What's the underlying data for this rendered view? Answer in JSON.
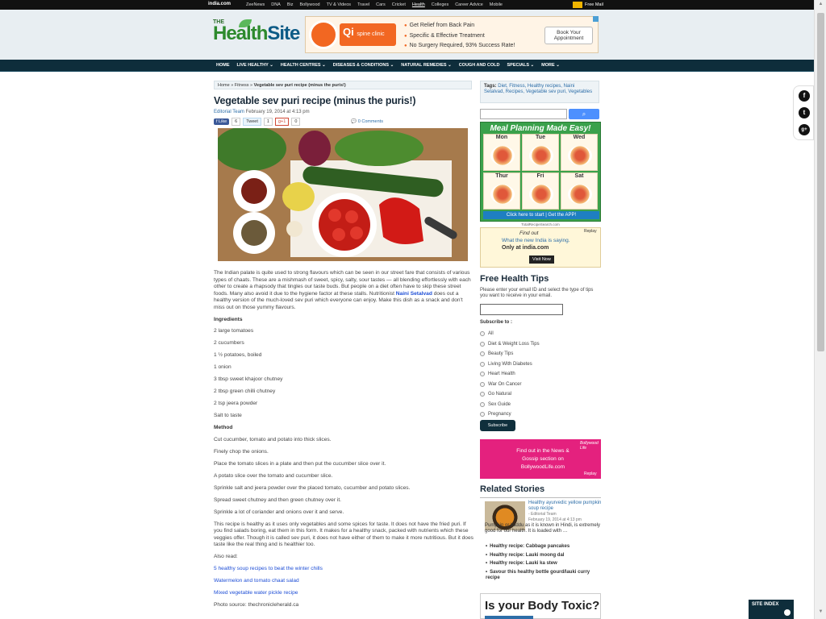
{
  "topbar": {
    "logo": "india.com",
    "nav": [
      "ZeeNews",
      "DNA",
      "Biz",
      "Bollywood",
      "TV & Videos",
      "Travel",
      "Cars",
      "Cricket",
      "Health",
      "Colleges",
      "Career Advice",
      "Mobile"
    ],
    "active": "Health",
    "mail": "Free Mail"
  },
  "header": {
    "logo_the": "THE",
    "logo_health": "Health",
    "logo_site": "Site"
  },
  "ad_banner": {
    "brand": "Qi",
    "brand_sub": "spine clinic",
    "bullets": [
      "Get Relief from Back Pain",
      "Specific & Effective Treatment",
      "No Surgery Required, 93% Success Rate!"
    ],
    "cta": "Book Your Appointment"
  },
  "mainnav": [
    "HOME",
    "LIVE HEALTHY ⌄",
    "HEALTH CENTRES ⌄",
    "DISEASES & CONDITIONS ⌄",
    "NATURAL REMEDIES ⌄",
    "COUGH AND COLD",
    "SPECIALS ⌄",
    "MORE ⌄"
  ],
  "social_float": [
    "f",
    "t",
    "g+"
  ],
  "breadcrumb": {
    "home": "Home",
    "sep": " » ",
    "section": "Fitness",
    "current": "Vegetable sev puri recipe (minus the puris!)"
  },
  "article": {
    "title": "Vegetable sev puri recipe (minus the puris!)",
    "author": "Editorial Team",
    "date": " February 19, 2014 at 4:13 pm",
    "share": {
      "fb": "f Like",
      "fb_count": "6",
      "tw": "Tweet",
      "tw_count": "1",
      "gp": "g+1",
      "gp_count": "0",
      "comments": "0 Comments"
    },
    "intro_a": "The Indian palate is quite used to strong flavours which can be seen in our street fare that consists of various types of chaats. These are a mishmash of sweet, spicy, salty, sour tastes — all blending effortlessly with each other to create a rhapsody that tingles our taste buds. But people on a diet often have to skip these street foods. Many also avoid it due to the hygiene factor at these stalls. Nutritionist ",
    "nutritionist": "Naini Setalvad",
    "intro_b": " does out a healthy version of the much-loved sev puri which everyone can enjoy. Make this dish as a snack and don't miss out on those yummy flavours.",
    "ingredients_heading": "Ingredients",
    "ingredients": [
      "2 large tomatoes",
      "2 cucumbers",
      "1 ½ potatoes, boiled",
      "1 onion",
      "3 tbsp sweet khajoor chutney",
      "2 tbsp green chilli chutney",
      "2 tsp jeera powder",
      "Salt to taste"
    ],
    "method_heading": "Method",
    "method": [
      "Cut cucumber, tomato and potato into thick slices.",
      "Finely chop the onions.",
      "Place the tomato slices in a plate and then put the cucumber slice over it.",
      "A potato slice over the tomato and cucumber slice.",
      "Sprinkle salt and jeera powder over the placed tomato, cucumber and potato slices.",
      "Spread sweet chutney and then green chutney over it.",
      "Sprinkle a lot of coriander and onions over it and serve."
    ],
    "closing": "This recipe is healthy as it uses only vegetables and some spices for taste. It does not have the fried puri. If you find salads boring, eat them in this form. It makes for a healthy snack, packed with nutrients which these veggies offer. Though it is called sev puri, it does not have either of them to make it more nutritious. But it does taste like the real thing and is healthier too.",
    "also_read": "Also read:",
    "links": [
      "5 healthy soup recipes to beat the winter chills",
      "Watermelon and tomato chaat salad",
      "Mixed vegetable water pickle recipe"
    ],
    "photo_source": "Photo source: thechronicleherald.ca"
  },
  "sidebar": {
    "tags_label": "Tags:",
    "tags": "Diet, Fitness, Healthy recipes, Naini Setalvad, Recipes, Vegetable sev puri, Vegetables",
    "meal_ad": {
      "title": "Meal Planning Made Easy!",
      "days": [
        "Mon",
        "Tue",
        "Wed",
        "Thur",
        "Fri",
        "Sat"
      ],
      "cta": "Click here to start  |  Get the APP!",
      "source": "TotalRecipeSearch.com"
    },
    "india_ad": {
      "l1": "Find out",
      "l2": "What the new India is saying.",
      "l3": "Only at india.com",
      "btn": "Visit Now",
      "replay": "Replay"
    },
    "free_tips": {
      "title": "Free Health Tips",
      "desc": "Please enter your email ID and select the type of tips you want to receive in your email.",
      "subscribe_to": "Subscribe to :",
      "options": [
        "All",
        "Diet & Weight Loss Tips",
        "Beauty Tips",
        "Living With Diabetes",
        "Heart Health",
        "War On Cancer",
        "Go Natural",
        "Sex Guide",
        "Pregnancy"
      ],
      "button": "Subscribe"
    },
    "bolly_ad": {
      "text": "Find out in the News & Gossip section on BollywoodLife.com",
      "brand": "Bollywood Life",
      "replay": "Replay"
    },
    "related": {
      "title": "Related Stories",
      "featured_title": "Healthy ayurvedic yellow pumpkin soup recipe",
      "featured_author": "- Editorial Team",
      "featured_date": "February 19, 2014 at 4:13 pm",
      "featured_excerpt": "Pumpkin or kaddu as it is known in Hindi, is extremely good for our health. It is loaded with …",
      "items": [
        "Healthy recipe: Cabbage pancakes",
        "Healthy recipe: Lauki moong dal",
        "Healthy recipe: Lauki ka stew",
        "Savour this healthy bottle gourd/lauki curry recipe"
      ]
    },
    "toxic_ad": "Is your Body Toxic?"
  },
  "site_index": "SITE INDEX"
}
